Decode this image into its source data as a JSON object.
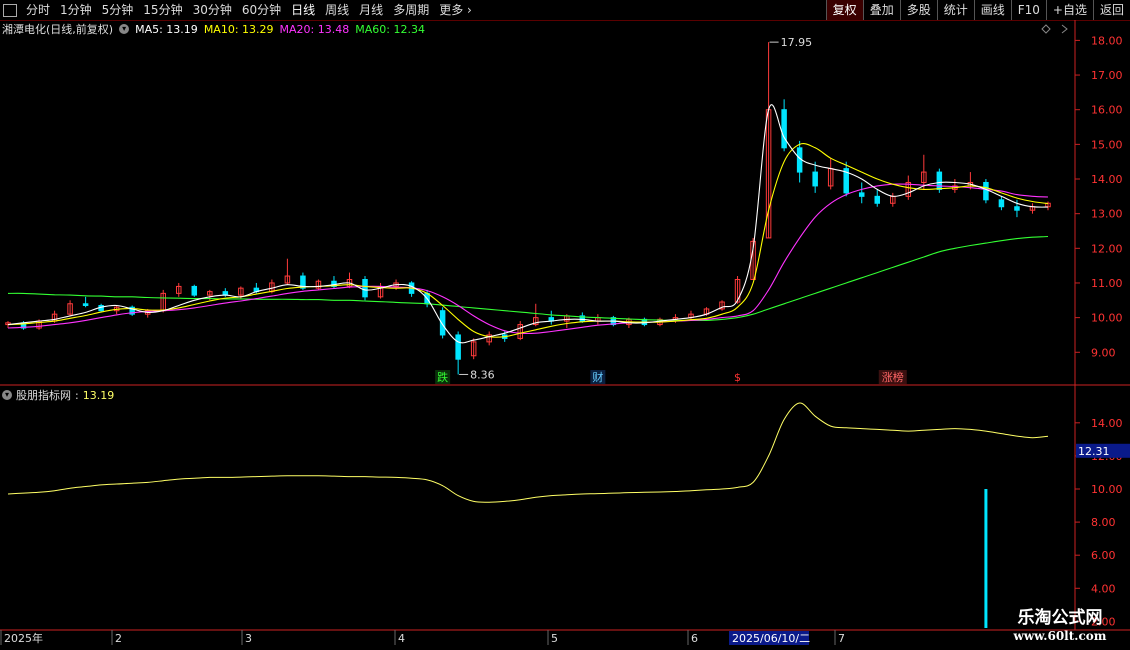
{
  "toolbar": {
    "left": [
      "分时",
      "1分钟",
      "5分钟",
      "15分钟",
      "30分钟",
      "60分钟",
      "日线",
      "周线",
      "月线",
      "多周期",
      "更多"
    ],
    "active": "日线",
    "right": [
      "复权",
      "叠加",
      "多股",
      "统计",
      "画线",
      "F10",
      "+自选",
      "返回"
    ]
  },
  "header": {
    "title": "湘潭电化(日线,前复权)",
    "ma": [
      {
        "text": "MA5: 13.19",
        "color": "#ffffff"
      },
      {
        "text": "MA10: 13.29",
        "color": "#ffff00"
      },
      {
        "text": "MA20: 13.48",
        "color": "#ff33ff"
      },
      {
        "text": "MA60: 12.34",
        "color": "#33ff33"
      }
    ]
  },
  "lower_header": {
    "title": "股朋指标网",
    "value": "13.19"
  },
  "colors": {
    "up": "#ff3b3b",
    "down": "#00e5ff",
    "ma5": "#ffffff",
    "ma10": "#ffff00",
    "ma20": "#ff33ff",
    "ma60": "#33ff33",
    "indicator": "#ffff66",
    "axis": "#cc2222",
    "bg": "#000000"
  },
  "chart_data": [
    {
      "type": "candlestick",
      "name_label": "湘潭电化(日线,前复权)",
      "ylim": [
        8.2,
        18.3
      ],
      "yticks": [
        "18.00",
        "17.00",
        "16.00",
        "15.00",
        "14.00",
        "13.00",
        "12.00",
        "11.00",
        "10.00",
        "9.00"
      ],
      "annotations": [
        {
          "text": "17.95",
          "value": 17.95
        },
        {
          "text": "8.36",
          "value": 8.36
        }
      ],
      "events": [
        {
          "text": "跌",
          "color": "#33ff33",
          "bg": "#0a300a",
          "index": 28
        },
        {
          "text": "财",
          "color": "#66ccff",
          "bg": "#0a2040",
          "index": 38
        },
        {
          "text": "$",
          "color": "#ff3333",
          "bg": "",
          "index": 47
        },
        {
          "text": "涨榜",
          "color": "#ff6666",
          "bg": "#3a1010",
          "index": 57
        }
      ],
      "ma_controls": [
        [
          0,
          9.8
        ],
        [
          8,
          10.2
        ],
        [
          14,
          10.6
        ],
        [
          22,
          10.9
        ],
        [
          27,
          10.6
        ],
        [
          31,
          9.3
        ],
        [
          40,
          9.8
        ],
        [
          50,
          9.9
        ],
        [
          54,
          10.2
        ],
        [
          56,
          12.0
        ],
        [
          58,
          17.2
        ],
        [
          60,
          14.6
        ],
        [
          63,
          14.3
        ],
        [
          66,
          13.5
        ],
        [
          70,
          13.9
        ],
        [
          75,
          13.2
        ]
      ],
      "ma5": [
        9.8,
        9.85,
        9.9,
        9.95,
        10.05,
        10.15,
        10.3,
        10.35,
        10.25,
        10.15,
        10.2,
        10.35,
        10.5,
        10.6,
        10.65,
        10.6,
        10.75,
        10.85,
        10.95,
        10.9,
        10.9,
        10.95,
        11.0,
        10.8,
        10.85,
        10.95,
        10.9,
        10.55,
        9.8,
        9.3,
        9.35,
        9.45,
        9.55,
        9.7,
        9.85,
        9.9,
        9.95,
        9.95,
        9.9,
        9.9,
        9.85,
        9.85,
        9.9,
        9.95,
        10.0,
        10.1,
        10.3,
        10.5,
        12.0,
        16.0,
        15.2,
        14.6,
        14.4,
        14.3,
        14.2,
        14.0,
        13.7,
        13.5,
        13.6,
        13.8,
        13.9,
        13.9,
        13.85,
        13.7,
        13.5,
        13.3,
        13.2,
        13.19
      ],
      "ma10": [
        9.8,
        9.82,
        9.86,
        9.9,
        9.98,
        10.06,
        10.16,
        10.24,
        10.26,
        10.22,
        10.22,
        10.28,
        10.38,
        10.48,
        10.56,
        10.6,
        10.68,
        10.76,
        10.84,
        10.88,
        10.9,
        10.92,
        10.95,
        10.9,
        10.87,
        10.85,
        10.85,
        10.7,
        10.35,
        9.95,
        9.6,
        9.45,
        9.45,
        9.55,
        9.65,
        9.75,
        9.83,
        9.88,
        9.9,
        9.9,
        9.88,
        9.87,
        9.87,
        9.9,
        9.94,
        9.98,
        10.1,
        10.3,
        11.0,
        13.1,
        14.5,
        15.0,
        14.9,
        14.6,
        14.4,
        14.2,
        14.0,
        13.85,
        13.75,
        13.7,
        13.72,
        13.75,
        13.8,
        13.75,
        13.6,
        13.45,
        13.35,
        13.29
      ],
      "ma20": [
        9.7,
        9.72,
        9.75,
        9.8,
        9.85,
        9.92,
        10.0,
        10.08,
        10.14,
        10.18,
        10.2,
        10.23,
        10.28,
        10.35,
        10.42,
        10.48,
        10.55,
        10.62,
        10.7,
        10.76,
        10.8,
        10.84,
        10.88,
        10.9,
        10.9,
        10.88,
        10.86,
        10.78,
        10.6,
        10.35,
        10.05,
        9.8,
        9.62,
        9.55,
        9.55,
        9.6,
        9.66,
        9.72,
        9.78,
        9.82,
        9.85,
        9.87,
        9.88,
        9.9,
        9.92,
        9.95,
        10.0,
        10.05,
        10.2,
        10.8,
        11.6,
        12.3,
        12.9,
        13.3,
        13.55,
        13.7,
        13.8,
        13.85,
        13.85,
        13.82,
        13.8,
        13.78,
        13.75,
        13.7,
        13.65,
        13.55,
        13.5,
        13.48
      ],
      "ma60": [
        10.7,
        10.7,
        10.68,
        10.66,
        10.65,
        10.63,
        10.62,
        10.6,
        10.6,
        10.58,
        10.57,
        10.56,
        10.55,
        10.55,
        10.54,
        10.54,
        10.53,
        10.53,
        10.53,
        10.52,
        10.52,
        10.5,
        10.5,
        10.48,
        10.46,
        10.44,
        10.42,
        10.4,
        10.36,
        10.32,
        10.28,
        10.24,
        10.2,
        10.16,
        10.12,
        10.08,
        10.05,
        10.02,
        10.0,
        9.98,
        9.96,
        9.94,
        9.93,
        9.92,
        9.92,
        9.92,
        9.95,
        10.0,
        10.1,
        10.25,
        10.4,
        10.55,
        10.7,
        10.85,
        11.0,
        11.15,
        11.3,
        11.45,
        11.6,
        11.75,
        11.9,
        12.0,
        12.08,
        12.15,
        12.22,
        12.28,
        12.32,
        12.34
      ],
      "candles": [
        [
          9.8,
          9.9,
          9.7,
          9.85
        ],
        [
          9.85,
          9.9,
          9.65,
          9.7
        ],
        [
          9.7,
          9.95,
          9.65,
          9.9
        ],
        [
          9.9,
          10.2,
          9.85,
          10.1
        ],
        [
          10.1,
          10.5,
          10.05,
          10.4
        ],
        [
          10.4,
          10.6,
          10.3,
          10.35
        ],
        [
          10.35,
          10.4,
          10.15,
          10.2
        ],
        [
          10.2,
          10.35,
          10.1,
          10.3
        ],
        [
          10.3,
          10.35,
          10.05,
          10.1
        ],
        [
          10.1,
          10.25,
          10.0,
          10.2
        ],
        [
          10.2,
          10.8,
          10.15,
          10.7
        ],
        [
          10.7,
          11.0,
          10.6,
          10.9
        ],
        [
          10.9,
          10.95,
          10.6,
          10.65
        ],
        [
          10.65,
          10.8,
          10.5,
          10.75
        ],
        [
          10.75,
          10.85,
          10.6,
          10.65
        ],
        [
          10.65,
          10.9,
          10.55,
          10.85
        ],
        [
          10.85,
          11.0,
          10.7,
          10.75
        ],
        [
          10.75,
          11.1,
          10.7,
          11.0
        ],
        [
          11.0,
          11.7,
          10.95,
          11.2
        ],
        [
          11.2,
          11.3,
          10.8,
          10.85
        ],
        [
          10.85,
          11.1,
          10.8,
          11.05
        ],
        [
          11.05,
          11.2,
          10.85,
          10.9
        ],
        [
          10.9,
          11.3,
          10.85,
          11.1
        ],
        [
          11.1,
          11.2,
          10.5,
          10.6
        ],
        [
          10.6,
          11.0,
          10.55,
          10.9
        ],
        [
          10.9,
          11.1,
          10.8,
          11.0
        ],
        [
          11.0,
          11.05,
          10.6,
          10.7
        ],
        [
          10.7,
          10.8,
          10.3,
          10.4
        ],
        [
          10.2,
          10.3,
          9.4,
          9.5
        ],
        [
          9.5,
          9.6,
          8.36,
          8.8
        ],
        [
          8.9,
          9.4,
          8.8,
          9.3
        ],
        [
          9.3,
          9.6,
          9.2,
          9.5
        ],
        [
          9.5,
          9.6,
          9.3,
          9.4
        ],
        [
          9.4,
          9.9,
          9.35,
          9.8
        ],
        [
          9.8,
          10.4,
          9.75,
          10.0
        ],
        [
          10.0,
          10.2,
          9.8,
          9.9
        ],
        [
          9.9,
          10.1,
          9.7,
          10.05
        ],
        [
          10.05,
          10.15,
          9.85,
          9.9
        ],
        [
          9.9,
          10.1,
          9.8,
          10.0
        ],
        [
          10.0,
          10.05,
          9.75,
          9.8
        ],
        [
          9.8,
          10.0,
          9.7,
          9.95
        ],
        [
          9.95,
          10.0,
          9.75,
          9.8
        ],
        [
          9.8,
          10.0,
          9.75,
          9.95
        ],
        [
          9.95,
          10.1,
          9.85,
          10.0
        ],
        [
          10.0,
          10.2,
          9.95,
          10.1
        ],
        [
          10.1,
          10.3,
          10.05,
          10.25
        ],
        [
          10.25,
          10.5,
          10.2,
          10.45
        ],
        [
          10.45,
          11.2,
          10.4,
          11.1
        ],
        [
          11.1,
          12.3,
          11.1,
          12.2
        ],
        [
          12.3,
          17.95,
          12.3,
          16.0
        ],
        [
          16.0,
          16.3,
          14.8,
          14.9
        ],
        [
          14.9,
          15.1,
          13.9,
          14.2
        ],
        [
          14.2,
          14.5,
          13.6,
          13.8
        ],
        [
          13.8,
          14.6,
          13.7,
          14.3
        ],
        [
          14.3,
          14.5,
          13.5,
          13.6
        ],
        [
          13.6,
          13.9,
          13.3,
          13.5
        ],
        [
          13.5,
          13.7,
          13.2,
          13.3
        ],
        [
          13.3,
          13.6,
          13.2,
          13.5
        ],
        [
          13.5,
          14.1,
          13.4,
          13.9
        ],
        [
          13.9,
          14.7,
          13.7,
          14.2
        ],
        [
          14.2,
          14.3,
          13.6,
          13.7
        ],
        [
          13.7,
          14.0,
          13.6,
          13.8
        ],
        [
          13.8,
          14.2,
          13.7,
          13.9
        ],
        [
          13.9,
          14.0,
          13.3,
          13.4
        ],
        [
          13.4,
          13.5,
          13.1,
          13.2
        ],
        [
          13.2,
          13.4,
          12.9,
          13.1
        ],
        [
          13.1,
          13.3,
          13.0,
          13.2
        ],
        [
          13.2,
          13.35,
          13.1,
          13.3
        ]
      ]
    },
    {
      "type": "line",
      "name_label": "股朋指标网",
      "ylim": [
        1.6,
        15.5
      ],
      "yticks": [
        "14.00",
        "12.00",
        "10.00",
        "8.00",
        "6.00",
        "4.00",
        "2.00"
      ],
      "last_value_label": "12.31",
      "bar": {
        "index": 63,
        "value": 10.0,
        "color": "#00e5ff"
      },
      "controls": [
        [
          0,
          9.7
        ],
        [
          7,
          10.3
        ],
        [
          12,
          10.7
        ],
        [
          18,
          10.8
        ],
        [
          27,
          10.6
        ],
        [
          31,
          9.2
        ],
        [
          42,
          9.8
        ],
        [
          53,
          10.3
        ],
        [
          56,
          12.0
        ],
        [
          58,
          15.2
        ],
        [
          61,
          13.4
        ],
        [
          70,
          13.5
        ],
        [
          75,
          13.1
        ]
      ],
      "series": [
        9.7,
        9.75,
        9.8,
        9.9,
        10.05,
        10.15,
        10.25,
        10.3,
        10.35,
        10.4,
        10.5,
        10.6,
        10.65,
        10.7,
        10.7,
        10.72,
        10.75,
        10.78,
        10.8,
        10.8,
        10.8,
        10.78,
        10.75,
        10.75,
        10.72,
        10.7,
        10.65,
        10.55,
        10.2,
        9.6,
        9.25,
        9.2,
        9.25,
        9.35,
        9.5,
        9.6,
        9.65,
        9.7,
        9.72,
        9.75,
        9.78,
        9.8,
        9.82,
        9.85,
        9.9,
        9.95,
        10.0,
        10.1,
        10.4,
        12.0,
        14.2,
        15.2,
        14.4,
        13.8,
        13.7,
        13.65,
        13.6,
        13.55,
        13.5,
        13.55,
        13.6,
        13.65,
        13.6,
        13.5,
        13.35,
        13.2,
        13.1,
        13.19
      ]
    }
  ],
  "date_axis": {
    "labels": [
      "2025年",
      "2",
      "3",
      "4",
      "5",
      "6",
      "7"
    ],
    "active_label": "2025/06/10/二"
  },
  "watermark": {
    "line1": "乐淘公式网",
    "line2": "www.60lt.com"
  }
}
